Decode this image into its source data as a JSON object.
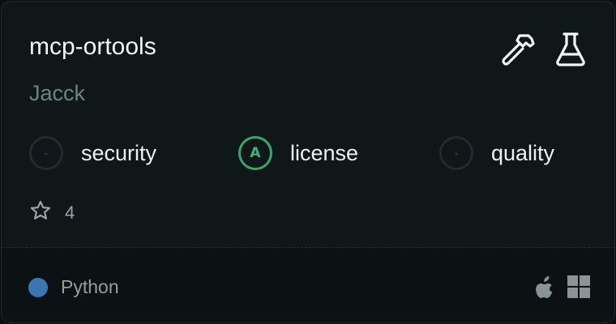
{
  "server": {
    "name": "mcp-ortools",
    "author": "Jacck"
  },
  "top_icons": [
    "hammer-icon",
    "flask-icon"
  ],
  "scores": [
    {
      "grade": "-",
      "label": "security"
    },
    {
      "grade": "A",
      "label": "license"
    },
    {
      "grade": "-",
      "label": "quality"
    }
  ],
  "stars": {
    "icon": "star-icon",
    "count": "4"
  },
  "footer": {
    "language": "Python",
    "language_color": "#3b76b0",
    "platforms": [
      "apple-icon",
      "windows-icon"
    ]
  },
  "colors": {
    "card_bg": "#101719",
    "grade_a": "#3aa66a",
    "author": "#6a8582"
  }
}
